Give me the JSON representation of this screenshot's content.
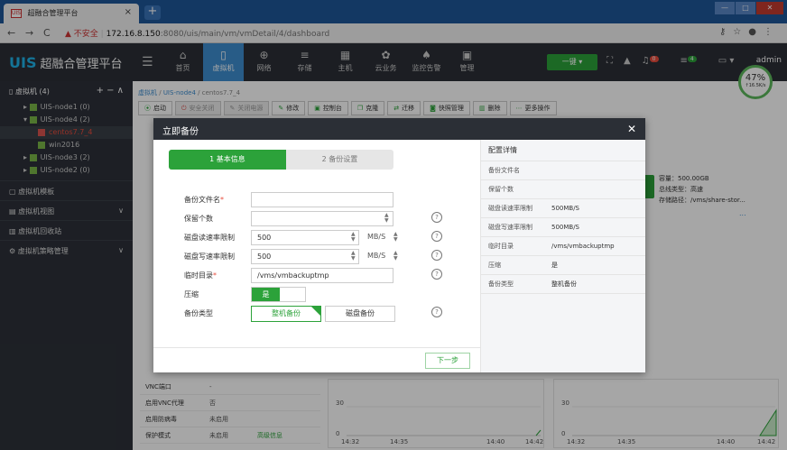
{
  "browser": {
    "tab_favicon": "UIS",
    "tab_title": "超融合管理平台",
    "tab_close": "×",
    "new_tab": "+",
    "url_warning": "▲ 不安全",
    "url_host": "172.16.8.150",
    "url_path": ":8080/uis/main/vm/vmDetail/4/dashboard",
    "win_min": "—",
    "win_max": "□",
    "win_close": "✕"
  },
  "header": {
    "logo": "UIS",
    "title": "超融合管理平台",
    "menu": [
      {
        "label": "首页",
        "icon": "home-icon"
      },
      {
        "label": "虚拟机",
        "icon": "vm-icon",
        "active": true
      },
      {
        "label": "网络",
        "icon": "network-icon"
      },
      {
        "label": "存储",
        "icon": "storage-icon"
      },
      {
        "label": "主机",
        "icon": "host-icon"
      },
      {
        "label": "云业务",
        "icon": "cloud-icon"
      },
      {
        "label": "监控告警",
        "icon": "alarm-icon"
      },
      {
        "label": "管理",
        "icon": "manage-icon"
      }
    ],
    "onekey_label": "一键 ▾",
    "alarm_count": "0",
    "task_count": "4",
    "user": "admin",
    "gauge_percent": "47%",
    "gauge_speed": "↑16.5K/s"
  },
  "sidebar": {
    "title": "虚拟机 (4)",
    "ops": "+ − ∧",
    "tree": [
      {
        "label": "UIS-node1 (0)",
        "level": 1
      },
      {
        "label": "UIS-node4 (2)",
        "level": 1
      },
      {
        "label": "centos7.7_4",
        "level": 3,
        "active": true
      },
      {
        "label": "win2016",
        "level": 3
      },
      {
        "label": "UIS-node3 (2)",
        "level": 1
      },
      {
        "label": "UIS-node2 (0)",
        "level": 1
      }
    ],
    "sections": [
      {
        "label": "虚拟机模板",
        "chevron": ""
      },
      {
        "label": "虚拟机视图",
        "chevron": "∨"
      },
      {
        "label": "虚拟机回收站",
        "chevron": ""
      },
      {
        "label": "虚拟机策略管理",
        "chevron": "∨"
      }
    ]
  },
  "main": {
    "crumb": [
      "虚拟机",
      "UIS-node4",
      "centos7.7_4"
    ],
    "toolbar": [
      {
        "label": "启动",
        "disabled": false
      },
      {
        "label": "安全关闭",
        "disabled": true
      },
      {
        "label": "关闭电源",
        "disabled": true
      },
      {
        "label": "修改",
        "disabled": false
      },
      {
        "label": "控制台",
        "disabled": false
      },
      {
        "label": "克隆",
        "disabled": false
      },
      {
        "label": "迁移",
        "disabled": false
      },
      {
        "label": "快照管理",
        "disabled": false
      },
      {
        "label": "删除",
        "disabled": false
      },
      {
        "label": "更多操作",
        "disabled": false
      }
    ],
    "capacity": {
      "size": "容量：500.00GB",
      "bus": "总线类型：高速",
      "path": "存储路径：/vms/share-stor..."
    },
    "more_link": "...",
    "info_rows": [
      {
        "k": "VNC端口",
        "v": "-",
        "link": ""
      },
      {
        "k": "启用VNC代理",
        "v": "否",
        "link": ""
      },
      {
        "k": "启用防病毒",
        "v": "未启用",
        "link": ""
      },
      {
        "k": "保护模式",
        "v": "未启用",
        "link": "高级信息"
      }
    ],
    "chart_left": {
      "y_top": "30",
      "y_bottom": "0",
      "x": [
        "14:32",
        "14:35",
        "14:40",
        "14:42"
      ]
    },
    "chart_right": {
      "y_top": "30",
      "y_bottom": "0",
      "x": [
        "14:32",
        "14:35",
        "14:40",
        "14:42"
      ]
    }
  },
  "modal": {
    "title": "立即备份",
    "close": "✕",
    "step1": "1 基本信息",
    "step2": "2 备份设置",
    "fields": {
      "filename_label": "备份文件名",
      "filename_value": "",
      "keep_label": "保留个数",
      "keep_value": "",
      "read_label": "磁盘读速率限制",
      "read_value": "500",
      "write_label": "磁盘写速率限制",
      "write_value": "500",
      "unit": "MB/S",
      "tmp_label": "临时目录",
      "tmp_value": "/vms/vmbackuptmp",
      "compress_label": "压缩",
      "compress_value": "是",
      "type_label": "备份类型",
      "type_full": "整机备份",
      "type_disk": "磁盘备份",
      "required_mark": "*",
      "help": "?"
    },
    "next": "下一步",
    "config": {
      "title": "配置详情",
      "rows": [
        {
          "k": "备份文件名",
          "v": ""
        },
        {
          "k": "保留个数",
          "v": ""
        },
        {
          "k": "磁盘读速率限制",
          "v": "500MB/S"
        },
        {
          "k": "磁盘写速率限制",
          "v": "500MB/S"
        },
        {
          "k": "临时目录",
          "v": "/vms/vmbackuptmp"
        },
        {
          "k": "压缩",
          "v": "是"
        },
        {
          "k": "备份类型",
          "v": "整机备份"
        }
      ]
    }
  }
}
